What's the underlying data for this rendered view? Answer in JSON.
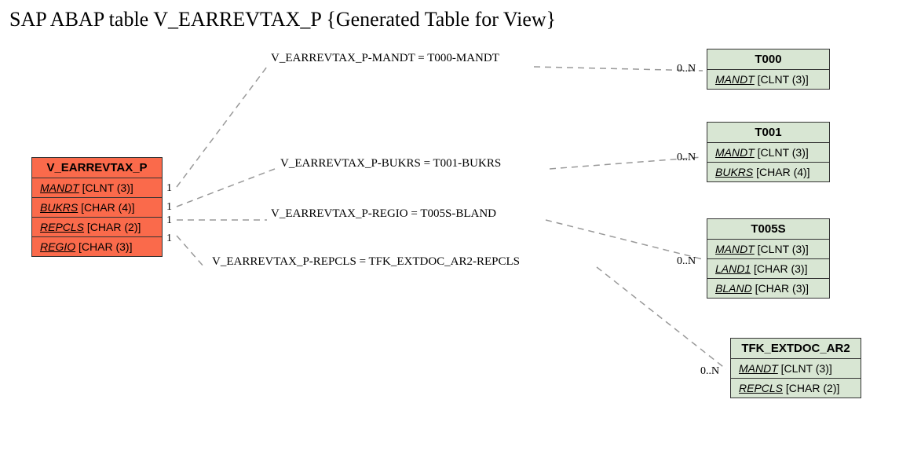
{
  "title": "SAP ABAP table V_EARREVTAX_P {Generated Table for View}",
  "source": {
    "name": "V_EARREVTAX_P",
    "fields": [
      {
        "fld": "MANDT",
        "type": "[CLNT (3)]"
      },
      {
        "fld": "BUKRS",
        "type": "[CHAR (4)]"
      },
      {
        "fld": "REPCLS",
        "type": "[CHAR (2)]"
      },
      {
        "fld": "REGIO",
        "type": "[CHAR (3)]"
      }
    ]
  },
  "targets": [
    {
      "name": "T000",
      "fields": [
        {
          "fld": "MANDT",
          "type": "[CLNT (3)]"
        }
      ]
    },
    {
      "name": "T001",
      "fields": [
        {
          "fld": "MANDT",
          "type": "[CLNT (3)]"
        },
        {
          "fld": "BUKRS",
          "type": "[CHAR (4)]"
        }
      ]
    },
    {
      "name": "T005S",
      "fields": [
        {
          "fld": "MANDT",
          "type": "[CLNT (3)]"
        },
        {
          "fld": "LAND1",
          "type": "[CHAR (3)]"
        },
        {
          "fld": "BLAND",
          "type": "[CHAR (3)]"
        }
      ]
    },
    {
      "name": "TFK_EXTDOC_AR2",
      "fields": [
        {
          "fld": "MANDT",
          "type": "[CLNT (3)]"
        },
        {
          "fld": "REPCLS",
          "type": "[CHAR (2)]"
        }
      ]
    }
  ],
  "relations": [
    {
      "label": "V_EARREVTAX_P-MANDT = T000-MANDT",
      "left_card": "1",
      "right_card": "0..N"
    },
    {
      "label": "V_EARREVTAX_P-BUKRS = T001-BUKRS",
      "left_card": "1",
      "right_card": "0..N"
    },
    {
      "label": "V_EARREVTAX_P-REGIO = T005S-BLAND",
      "left_card": "1",
      "right_card": "0..N"
    },
    {
      "label": "V_EARREVTAX_P-REPCLS = TFK_EXTDOC_AR2-REPCLS",
      "left_card": "1",
      "right_card": "0..N"
    }
  ]
}
